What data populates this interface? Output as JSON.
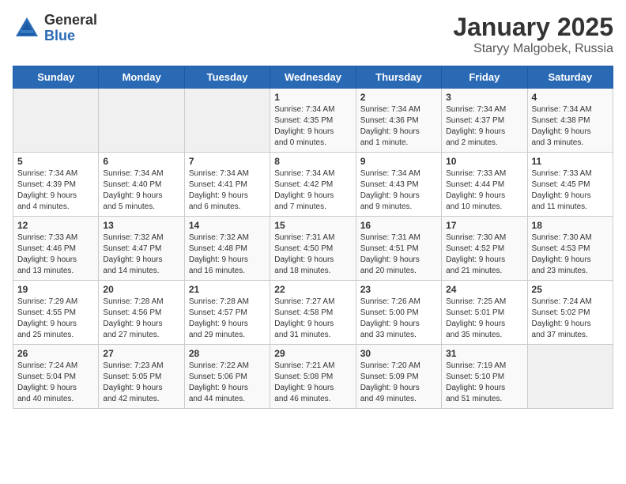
{
  "header": {
    "logo_general": "General",
    "logo_blue": "Blue",
    "title": "January 2025",
    "location": "Staryy Malgobek, Russia"
  },
  "weekdays": [
    "Sunday",
    "Monday",
    "Tuesday",
    "Wednesday",
    "Thursday",
    "Friday",
    "Saturday"
  ],
  "weeks": [
    [
      {
        "day": "",
        "info": ""
      },
      {
        "day": "",
        "info": ""
      },
      {
        "day": "",
        "info": ""
      },
      {
        "day": "1",
        "info": "Sunrise: 7:34 AM\nSunset: 4:35 PM\nDaylight: 9 hours\nand 0 minutes."
      },
      {
        "day": "2",
        "info": "Sunrise: 7:34 AM\nSunset: 4:36 PM\nDaylight: 9 hours\nand 1 minute."
      },
      {
        "day": "3",
        "info": "Sunrise: 7:34 AM\nSunset: 4:37 PM\nDaylight: 9 hours\nand 2 minutes."
      },
      {
        "day": "4",
        "info": "Sunrise: 7:34 AM\nSunset: 4:38 PM\nDaylight: 9 hours\nand 3 minutes."
      }
    ],
    [
      {
        "day": "5",
        "info": "Sunrise: 7:34 AM\nSunset: 4:39 PM\nDaylight: 9 hours\nand 4 minutes."
      },
      {
        "day": "6",
        "info": "Sunrise: 7:34 AM\nSunset: 4:40 PM\nDaylight: 9 hours\nand 5 minutes."
      },
      {
        "day": "7",
        "info": "Sunrise: 7:34 AM\nSunset: 4:41 PM\nDaylight: 9 hours\nand 6 minutes."
      },
      {
        "day": "8",
        "info": "Sunrise: 7:34 AM\nSunset: 4:42 PM\nDaylight: 9 hours\nand 7 minutes."
      },
      {
        "day": "9",
        "info": "Sunrise: 7:34 AM\nSunset: 4:43 PM\nDaylight: 9 hours\nand 9 minutes."
      },
      {
        "day": "10",
        "info": "Sunrise: 7:33 AM\nSunset: 4:44 PM\nDaylight: 9 hours\nand 10 minutes."
      },
      {
        "day": "11",
        "info": "Sunrise: 7:33 AM\nSunset: 4:45 PM\nDaylight: 9 hours\nand 11 minutes."
      }
    ],
    [
      {
        "day": "12",
        "info": "Sunrise: 7:33 AM\nSunset: 4:46 PM\nDaylight: 9 hours\nand 13 minutes."
      },
      {
        "day": "13",
        "info": "Sunrise: 7:32 AM\nSunset: 4:47 PM\nDaylight: 9 hours\nand 14 minutes."
      },
      {
        "day": "14",
        "info": "Sunrise: 7:32 AM\nSunset: 4:48 PM\nDaylight: 9 hours\nand 16 minutes."
      },
      {
        "day": "15",
        "info": "Sunrise: 7:31 AM\nSunset: 4:50 PM\nDaylight: 9 hours\nand 18 minutes."
      },
      {
        "day": "16",
        "info": "Sunrise: 7:31 AM\nSunset: 4:51 PM\nDaylight: 9 hours\nand 20 minutes."
      },
      {
        "day": "17",
        "info": "Sunrise: 7:30 AM\nSunset: 4:52 PM\nDaylight: 9 hours\nand 21 minutes."
      },
      {
        "day": "18",
        "info": "Sunrise: 7:30 AM\nSunset: 4:53 PM\nDaylight: 9 hours\nand 23 minutes."
      }
    ],
    [
      {
        "day": "19",
        "info": "Sunrise: 7:29 AM\nSunset: 4:55 PM\nDaylight: 9 hours\nand 25 minutes."
      },
      {
        "day": "20",
        "info": "Sunrise: 7:28 AM\nSunset: 4:56 PM\nDaylight: 9 hours\nand 27 minutes."
      },
      {
        "day": "21",
        "info": "Sunrise: 7:28 AM\nSunset: 4:57 PM\nDaylight: 9 hours\nand 29 minutes."
      },
      {
        "day": "22",
        "info": "Sunrise: 7:27 AM\nSunset: 4:58 PM\nDaylight: 9 hours\nand 31 minutes."
      },
      {
        "day": "23",
        "info": "Sunrise: 7:26 AM\nSunset: 5:00 PM\nDaylight: 9 hours\nand 33 minutes."
      },
      {
        "day": "24",
        "info": "Sunrise: 7:25 AM\nSunset: 5:01 PM\nDaylight: 9 hours\nand 35 minutes."
      },
      {
        "day": "25",
        "info": "Sunrise: 7:24 AM\nSunset: 5:02 PM\nDaylight: 9 hours\nand 37 minutes."
      }
    ],
    [
      {
        "day": "26",
        "info": "Sunrise: 7:24 AM\nSunset: 5:04 PM\nDaylight: 9 hours\nand 40 minutes."
      },
      {
        "day": "27",
        "info": "Sunrise: 7:23 AM\nSunset: 5:05 PM\nDaylight: 9 hours\nand 42 minutes."
      },
      {
        "day": "28",
        "info": "Sunrise: 7:22 AM\nSunset: 5:06 PM\nDaylight: 9 hours\nand 44 minutes."
      },
      {
        "day": "29",
        "info": "Sunrise: 7:21 AM\nSunset: 5:08 PM\nDaylight: 9 hours\nand 46 minutes."
      },
      {
        "day": "30",
        "info": "Sunrise: 7:20 AM\nSunset: 5:09 PM\nDaylight: 9 hours\nand 49 minutes."
      },
      {
        "day": "31",
        "info": "Sunrise: 7:19 AM\nSunset: 5:10 PM\nDaylight: 9 hours\nand 51 minutes."
      },
      {
        "day": "",
        "info": ""
      }
    ]
  ]
}
